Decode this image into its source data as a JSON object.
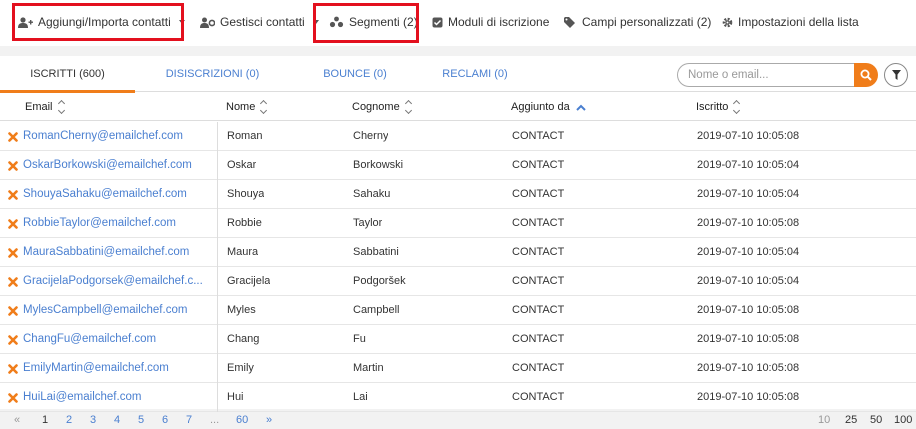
{
  "toolbar": {
    "add_import": "Aggiungi/Importa contatti",
    "manage": "Gestisci contatti",
    "segments": "Segmenti (2)",
    "forms": "Moduli di iscrizione",
    "custom_fields": "Campi personalizzati (2)",
    "list_settings": "Impostazioni della lista"
  },
  "tabs": {
    "subscribed": "ISCRITTI (600)",
    "unsubscribed": "DISISCRIZIONI (0)",
    "bounce": "BOUNCE (0)",
    "complaints": "RECLAMI (0)"
  },
  "search": {
    "placeholder": "Nome o email..."
  },
  "columns": {
    "email": "Email",
    "name": "Nome",
    "surname": "Cognome",
    "added_by": "Aggiunto da",
    "subscribed": "Iscritto"
  },
  "rows": [
    {
      "email": "RomanCherny@emailchef.com",
      "name": "Roman",
      "surname": "Cherny",
      "added_by": "CONTACT",
      "date": "2019-07-10 10:05:08"
    },
    {
      "email": "OskarBorkowski@emailchef.com",
      "name": "Oskar",
      "surname": "Borkowski",
      "added_by": "CONTACT",
      "date": "2019-07-10 10:05:04"
    },
    {
      "email": "ShouyaSahaku@emailchef.com",
      "name": "Shouya",
      "surname": "Sahaku",
      "added_by": "CONTACT",
      "date": "2019-07-10 10:05:04"
    },
    {
      "email": "RobbieTaylor@emailchef.com",
      "name": "Robbie",
      "surname": "Taylor",
      "added_by": "CONTACT",
      "date": "2019-07-10 10:05:08"
    },
    {
      "email": "MauraSabbatini@emailchef.com",
      "name": "Maura",
      "surname": "Sabbatini",
      "added_by": "CONTACT",
      "date": "2019-07-10 10:05:04"
    },
    {
      "email": "GracijelaPodgorsek@emailchef.c...",
      "name": "Gracijela",
      "surname": "Podgoršek",
      "added_by": "CONTACT",
      "date": "2019-07-10 10:05:04"
    },
    {
      "email": "MylesCampbell@emailchef.com",
      "name": "Myles",
      "surname": "Campbell",
      "added_by": "CONTACT",
      "date": "2019-07-10 10:05:08"
    },
    {
      "email": "ChangFu@emailchef.com",
      "name": "Chang",
      "surname": "Fu",
      "added_by": "CONTACT",
      "date": "2019-07-10 10:05:08"
    },
    {
      "email": "EmilyMartin@emailchef.com",
      "name": "Emily",
      "surname": "Martin",
      "added_by": "CONTACT",
      "date": "2019-07-10 10:05:08"
    },
    {
      "email": "HuiLai@emailchef.com",
      "name": "Hui",
      "surname": "Lai",
      "added_by": "CONTACT",
      "date": "2019-07-10 10:05:08"
    }
  ],
  "pagination": {
    "prev": "«",
    "pages": [
      "1",
      "2",
      "3",
      "4",
      "5",
      "6",
      "7"
    ],
    "ellipsis": "...",
    "last": "60",
    "next": "»",
    "page_sizes": [
      "10",
      "25",
      "50",
      "100"
    ]
  },
  "colors": {
    "accent": "#f07d1a",
    "link": "#4a7fd0",
    "highlight": "#e3101e"
  }
}
